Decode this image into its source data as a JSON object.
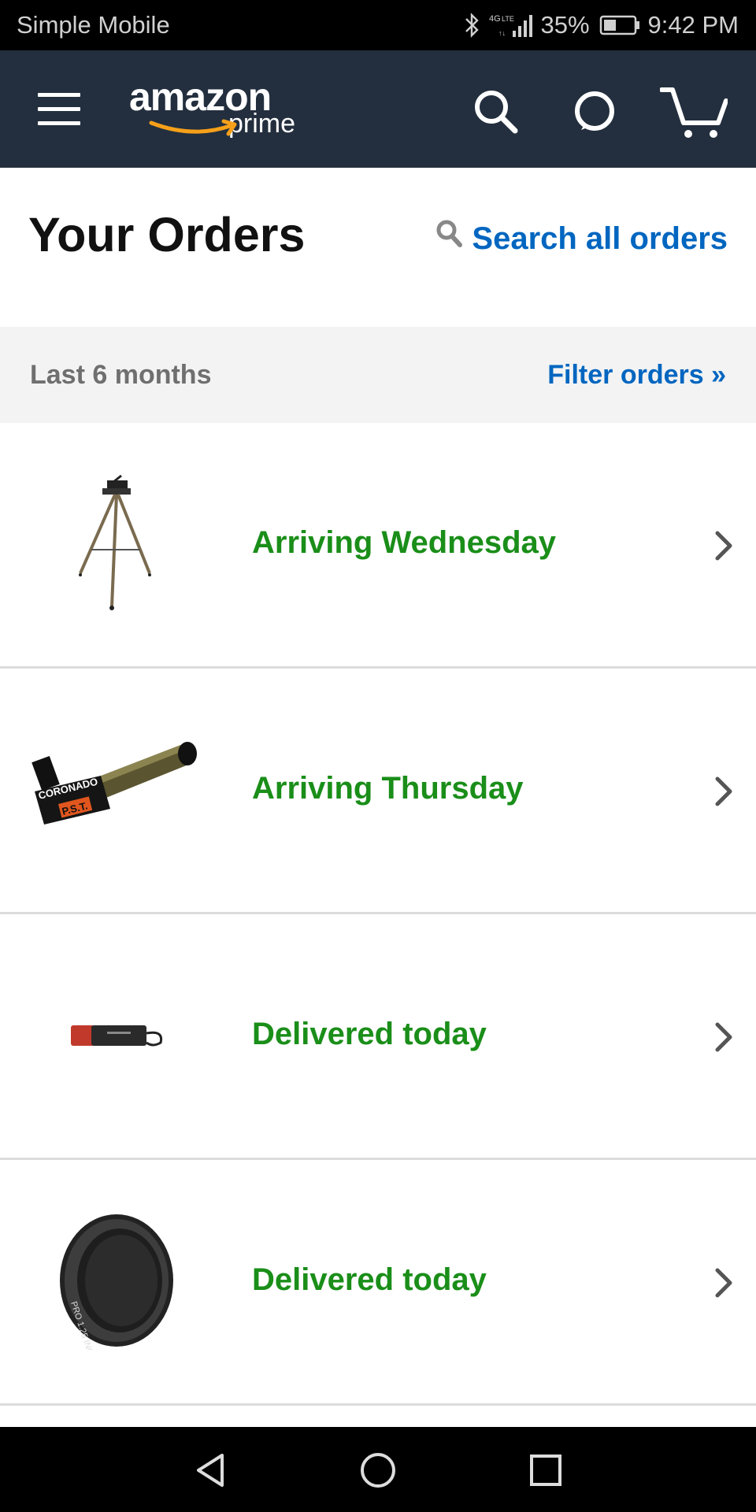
{
  "status_bar": {
    "carrier": "Simple Mobile",
    "network": "4G LTE",
    "battery": "35%",
    "time": "9:42 PM"
  },
  "header": {
    "logo_text": "amazon",
    "logo_sub": "prime",
    "icons": [
      "menu-icon",
      "search-icon",
      "alexa-icon",
      "cart-icon"
    ],
    "bg_color": "#232f3e"
  },
  "page": {
    "title": "Your Orders",
    "search_link": "Search all orders"
  },
  "filter": {
    "range": "Last 6 months",
    "filter_link": "Filter orders »"
  },
  "orders": [
    {
      "status": "Arriving Wednesday",
      "thumbnail": "tripod"
    },
    {
      "status": "Arriving Thursday",
      "thumbnail": "coronado-pst-telescope"
    },
    {
      "status": "Delivered today",
      "thumbnail": "red-flashlight"
    },
    {
      "status": "Delivered today",
      "thumbnail": "eyepiece-filter"
    }
  ],
  "colors": {
    "link": "#0066c0",
    "status_green": "#1a8e19",
    "smile_orange": "#f6a01a"
  }
}
